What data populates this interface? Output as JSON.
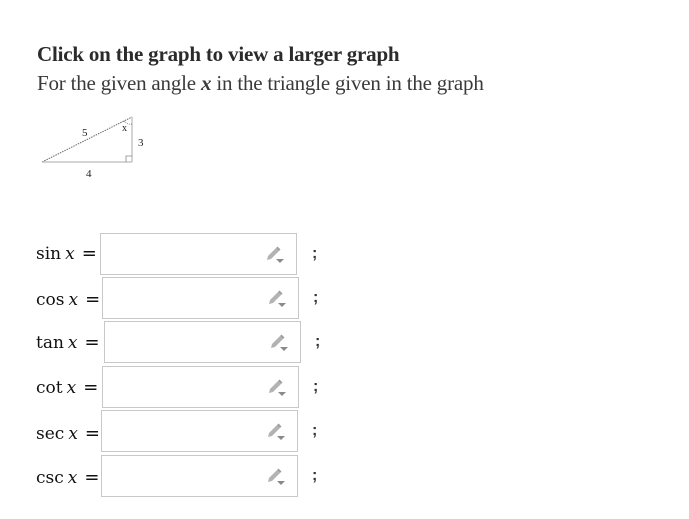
{
  "header": {
    "title": "Click on the graph to view a larger graph",
    "subtitle_before": "For the given angle ",
    "subtitle_var": "x",
    "subtitle_after": " in the triangle given in the graph"
  },
  "graph": {
    "hypotenuse_label": "5",
    "adjacent_label": "4",
    "opposite_label": "3",
    "angle_label": "x"
  },
  "rows": [
    {
      "fn": "sin",
      "var": "x",
      "eq": "=",
      "value": "",
      "separator": ";",
      "icon": "pencil-dropdown-icon"
    },
    {
      "fn": "cos",
      "var": "x",
      "eq": "=",
      "value": "",
      "separator": ";",
      "icon": "pencil-dropdown-icon"
    },
    {
      "fn": "tan",
      "var": "x",
      "eq": "=",
      "value": "",
      "separator": ";",
      "icon": "pencil-dropdown-icon"
    },
    {
      "fn": "cot",
      "var": "x",
      "eq": "=",
      "value": "",
      "separator": ";",
      "icon": "pencil-dropdown-icon"
    },
    {
      "fn": "sec",
      "var": "x",
      "eq": "=",
      "value": "",
      "separator": ";",
      "icon": "pencil-dropdown-icon"
    },
    {
      "fn": "csc",
      "var": "x",
      "eq": "=",
      "value": "",
      "separator": ";",
      "icon": "pencil-dropdown-icon"
    }
  ]
}
